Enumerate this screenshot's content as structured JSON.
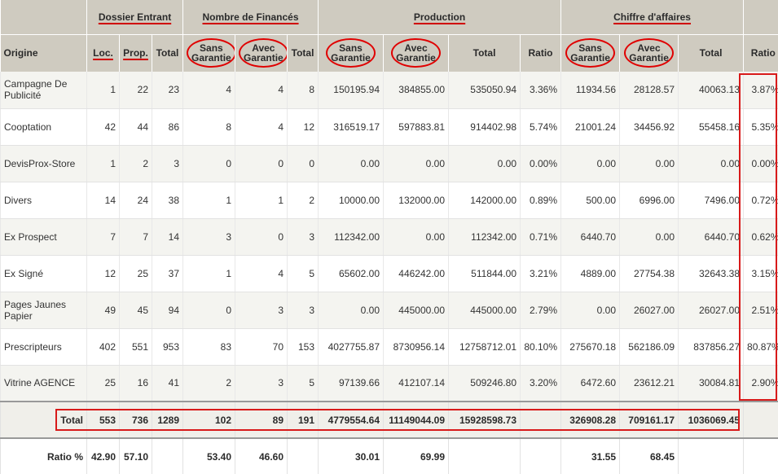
{
  "headers": {
    "groups": {
      "dossier": "Dossier Entrant",
      "finances": "Nombre de Financés",
      "production": "Production",
      "ca": "Chiffre d'affaires"
    },
    "origine": "Origine",
    "loc": "Loc.",
    "prop": "Prop.",
    "total": "Total",
    "sans_line1": "Sans",
    "avec_line1": "Avec",
    "garantie": "Garantie",
    "ratio": "Ratio"
  },
  "rows": [
    {
      "origine": "Campagne De Publicité",
      "loc": "1",
      "prop": "22",
      "total": "23",
      "nf_sans": "4",
      "nf_avec": "4",
      "nf_total": "8",
      "prod_sans": "150195.94",
      "prod_avec": "384855.00",
      "prod_total": "535050.94",
      "prod_ratio": "3.36%",
      "ca_sans": "11934.56",
      "ca_avec": "28128.57",
      "ca_total": "40063.13",
      "ca_ratio": "3.87%"
    },
    {
      "origine": "Cooptation",
      "loc": "42",
      "prop": "44",
      "total": "86",
      "nf_sans": "8",
      "nf_avec": "4",
      "nf_total": "12",
      "prod_sans": "316519.17",
      "prod_avec": "597883.81",
      "prod_total": "914402.98",
      "prod_ratio": "5.74%",
      "ca_sans": "21001.24",
      "ca_avec": "34456.92",
      "ca_total": "55458.16",
      "ca_ratio": "5.35%"
    },
    {
      "origine": "DevisProx-Store",
      "loc": "1",
      "prop": "2",
      "total": "3",
      "nf_sans": "0",
      "nf_avec": "0",
      "nf_total": "0",
      "prod_sans": "0.00",
      "prod_avec": "0.00",
      "prod_total": "0.00",
      "prod_ratio": "0.00%",
      "ca_sans": "0.00",
      "ca_avec": "0.00",
      "ca_total": "0.00",
      "ca_ratio": "0.00%"
    },
    {
      "origine": "Divers",
      "loc": "14",
      "prop": "24",
      "total": "38",
      "nf_sans": "1",
      "nf_avec": "1",
      "nf_total": "2",
      "prod_sans": "10000.00",
      "prod_avec": "132000.00",
      "prod_total": "142000.00",
      "prod_ratio": "0.89%",
      "ca_sans": "500.00",
      "ca_avec": "6996.00",
      "ca_total": "7496.00",
      "ca_ratio": "0.72%"
    },
    {
      "origine": "Ex Prospect",
      "loc": "7",
      "prop": "7",
      "total": "14",
      "nf_sans": "3",
      "nf_avec": "0",
      "nf_total": "3",
      "prod_sans": "112342.00",
      "prod_avec": "0.00",
      "prod_total": "112342.00",
      "prod_ratio": "0.71%",
      "ca_sans": "6440.70",
      "ca_avec": "0.00",
      "ca_total": "6440.70",
      "ca_ratio": "0.62%"
    },
    {
      "origine": "Ex Signé",
      "loc": "12",
      "prop": "25",
      "total": "37",
      "nf_sans": "1",
      "nf_avec": "4",
      "nf_total": "5",
      "prod_sans": "65602.00",
      "prod_avec": "446242.00",
      "prod_total": "511844.00",
      "prod_ratio": "3.21%",
      "ca_sans": "4889.00",
      "ca_avec": "27754.38",
      "ca_total": "32643.38",
      "ca_ratio": "3.15%"
    },
    {
      "origine": "Pages Jaunes Papier",
      "loc": "49",
      "prop": "45",
      "total": "94",
      "nf_sans": "0",
      "nf_avec": "3",
      "nf_total": "3",
      "prod_sans": "0.00",
      "prod_avec": "445000.00",
      "prod_total": "445000.00",
      "prod_ratio": "2.79%",
      "ca_sans": "0.00",
      "ca_avec": "26027.00",
      "ca_total": "26027.00",
      "ca_ratio": "2.51%"
    },
    {
      "origine": "Prescripteurs",
      "loc": "402",
      "prop": "551",
      "total": "953",
      "nf_sans": "83",
      "nf_avec": "70",
      "nf_total": "153",
      "prod_sans": "4027755.87",
      "prod_avec": "8730956.14",
      "prod_total": "12758712.01",
      "prod_ratio": "80.10%",
      "ca_sans": "275670.18",
      "ca_avec": "562186.09",
      "ca_total": "837856.27",
      "ca_ratio": "80.87%"
    },
    {
      "origine": "Vitrine AGENCE",
      "loc": "25",
      "prop": "16",
      "total": "41",
      "nf_sans": "2",
      "nf_avec": "3",
      "nf_total": "5",
      "prod_sans": "97139.66",
      "prod_avec": "412107.14",
      "prod_total": "509246.80",
      "prod_ratio": "3.20%",
      "ca_sans": "6472.60",
      "ca_avec": "23612.21",
      "ca_total": "30084.81",
      "ca_ratio": "2.90%"
    }
  ],
  "totals": {
    "label": "Total",
    "loc": "553",
    "prop": "736",
    "total": "1289",
    "nf_sans": "102",
    "nf_avec": "89",
    "nf_total": "191",
    "prod_sans": "4779554.64",
    "prod_avec": "11149044.09",
    "prod_total": "15928598.73",
    "ca_sans": "326908.28",
    "ca_avec": "709161.17",
    "ca_total": "1036069.45"
  },
  "ratios": {
    "label": "Ratio %",
    "loc": "42.90",
    "prop": "57.10",
    "nf_sans": "53.40",
    "nf_avec": "46.60",
    "prod_sans": "30.01",
    "prod_avec": "69.99",
    "ca_sans": "31.55",
    "ca_avec": "68.45"
  }
}
